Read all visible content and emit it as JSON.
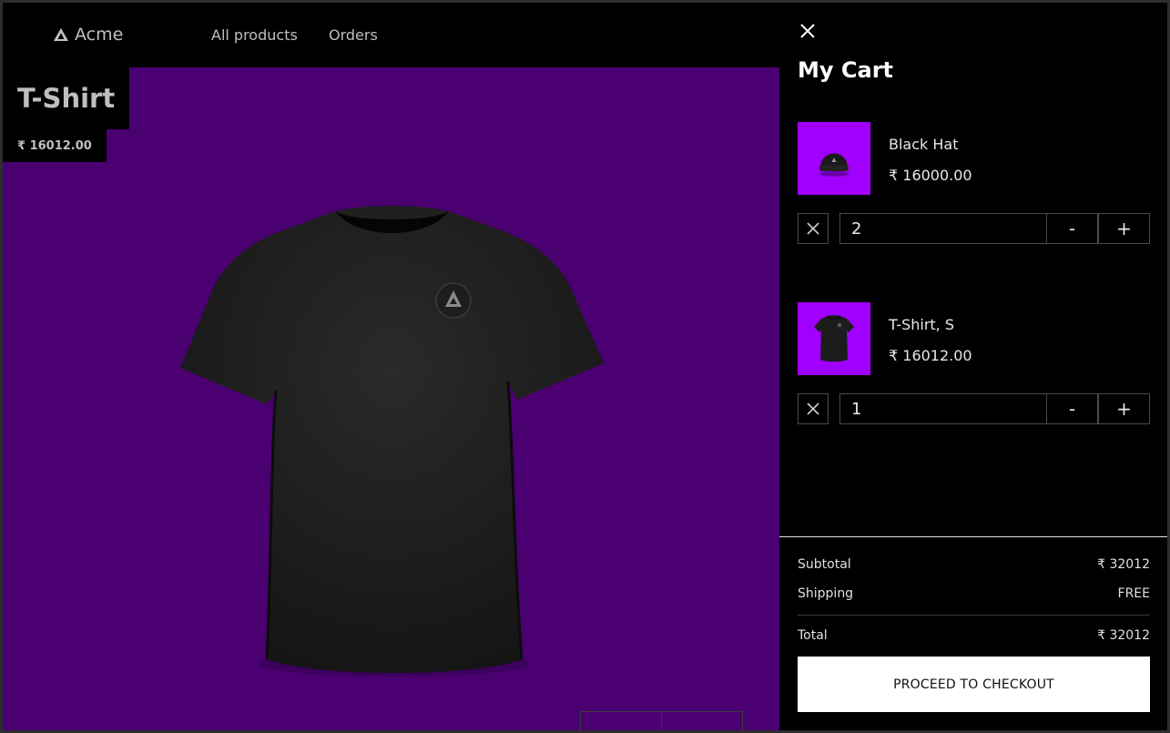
{
  "header": {
    "brand": "Acme",
    "nav": [
      "All products",
      "Orders"
    ]
  },
  "product": {
    "title": "T-Shirt",
    "price": "₹ 16012.00"
  },
  "cart": {
    "title": "My Cart",
    "items": [
      {
        "name": "Black Hat",
        "price": "₹ 16000.00",
        "quantity": "2",
        "decrement": "-",
        "increment": "+"
      },
      {
        "name": "T-Shirt, S",
        "price": "₹ 16012.00",
        "quantity": "1",
        "decrement": "-",
        "increment": "+"
      }
    ],
    "summary": {
      "subtotal_label": "Subtotal",
      "subtotal_value": "₹ 32012",
      "shipping_label": "Shipping",
      "shipping_value": "FREE",
      "total_label": "Total",
      "total_value": "₹ 32012"
    },
    "checkout_label": "PROCEED TO CHECKOUT"
  },
  "colors": {
    "stage_background": "#4a0070",
    "thumbnail_background": "#a100ff",
    "page_background": "#000000"
  },
  "icons": [
    "acme-logo-icon",
    "close-icon",
    "remove-icon"
  ]
}
